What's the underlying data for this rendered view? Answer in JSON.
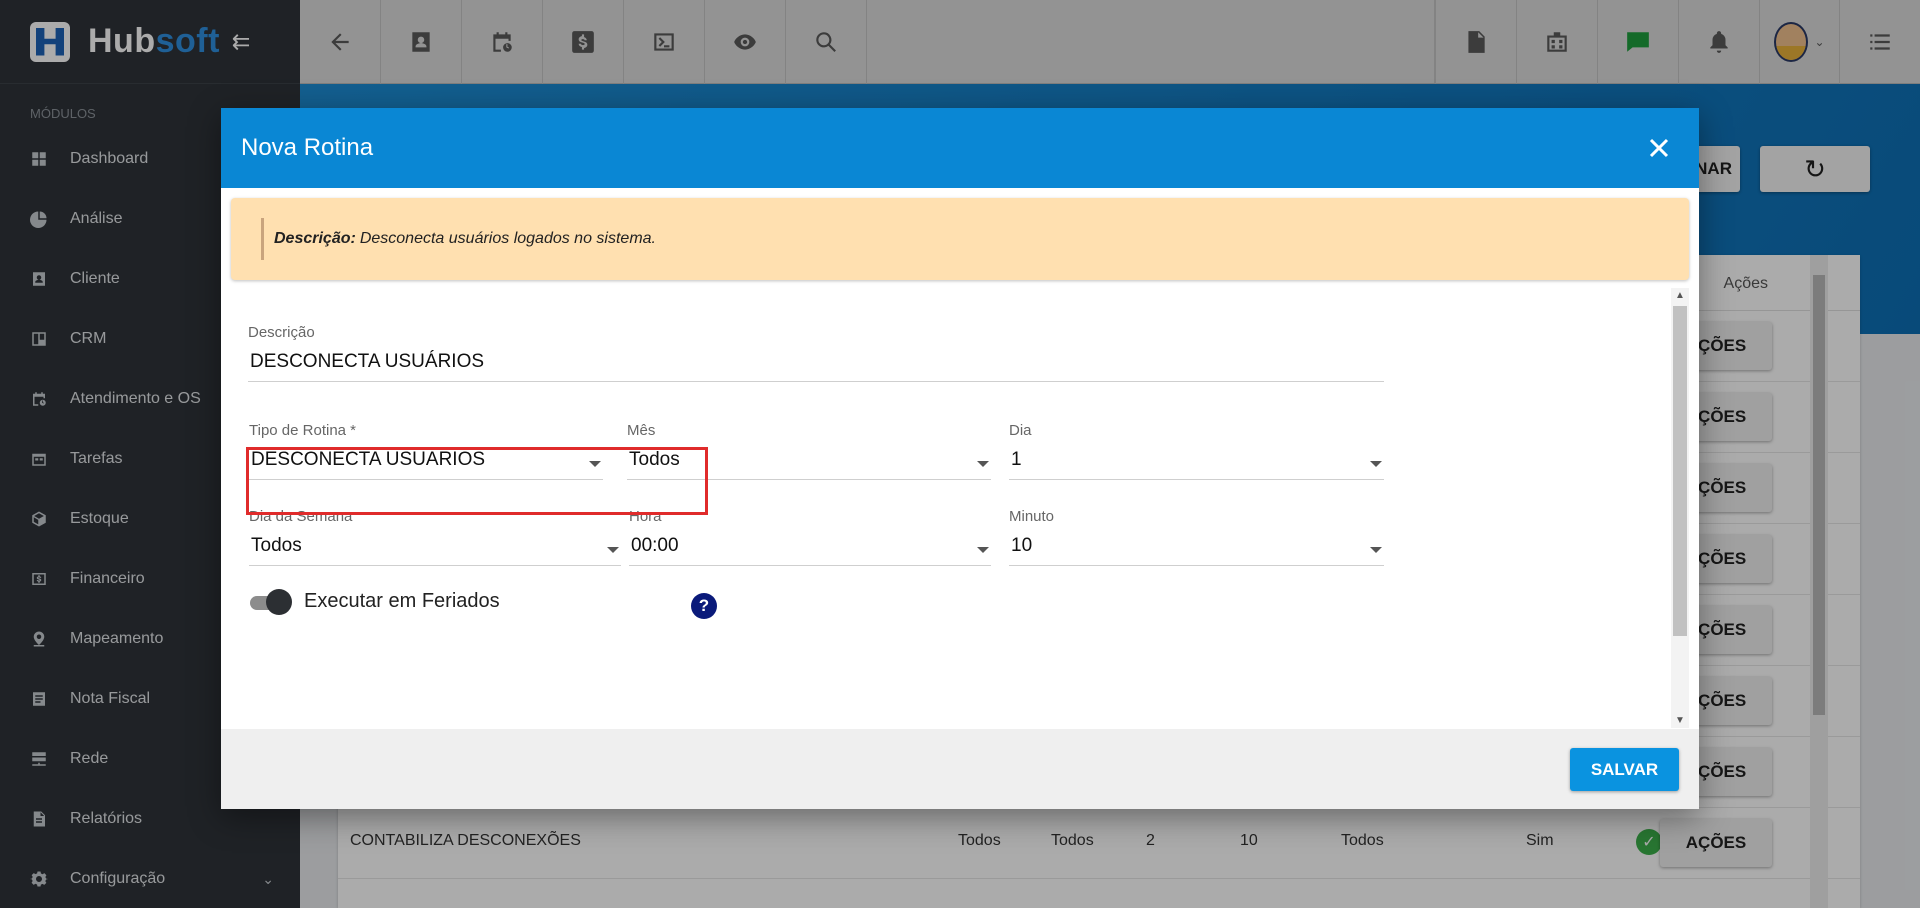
{
  "brand": {
    "name_prefix": "Hub",
    "name_suffix": "soft",
    "collapse_icon": "collapse-left-icon"
  },
  "sidebar": {
    "section_title": "MÓDULOS",
    "items": [
      {
        "label": "Dashboard",
        "icon": "dashboard-icon"
      },
      {
        "label": "Análise",
        "icon": "pie-chart-icon"
      },
      {
        "label": "Cliente",
        "icon": "contact-card-icon"
      },
      {
        "label": "CRM",
        "icon": "board-icon"
      },
      {
        "label": "Atendimento e OS",
        "icon": "calendar-clock-icon"
      },
      {
        "label": "Tarefas",
        "icon": "tasks-icon"
      },
      {
        "label": "Estoque",
        "icon": "box-icon"
      },
      {
        "label": "Financeiro",
        "icon": "money-icon"
      },
      {
        "label": "Mapeamento",
        "icon": "map-pin-icon"
      },
      {
        "label": "Nota Fiscal",
        "icon": "document-icon"
      },
      {
        "label": "Rede",
        "icon": "server-icon"
      },
      {
        "label": "Relatórios",
        "icon": "report-icon"
      },
      {
        "label": "Configuração",
        "icon": "gear-icon"
      }
    ]
  },
  "topbar": {
    "left_icons": [
      "back-arrow-icon",
      "contact-icon",
      "calendar-clock-icon",
      "dollar-icon",
      "terminal-icon",
      "eye-icon",
      "search-icon"
    ],
    "right_icons": [
      "pdf-icon",
      "building-icon",
      "chat-check-icon",
      "bell-icon",
      "avatar",
      "menu-list-icon"
    ]
  },
  "background": {
    "header_buttons": {
      "partial_label": "NAR",
      "refresh_icon": "refresh-icon"
    },
    "table": {
      "actions_header": "Ações",
      "action_button": "AÇÕES",
      "visible_row": {
        "descricao": "CONTABILIZA DESCONEXÕES",
        "mes": "Todos",
        "dia_semana": "Todos",
        "hora": "2",
        "minuto": "10",
        "dia": "Todos",
        "feriados": "Sim",
        "status_icon": "check-circle-icon"
      }
    }
  },
  "modal": {
    "title": "Nova Rotina",
    "info": {
      "label": "Descrição:",
      "text": "Desconecta usuários logados no sistema."
    },
    "fields": {
      "descricao": {
        "label": "Descrição",
        "value": "DESCONECTA USUÁRIOS"
      },
      "tipo_rotina": {
        "label": "Tipo de Rotina *",
        "value": "DESCONECTA USUARIOS"
      },
      "mes": {
        "label": "Mês",
        "value": "Todos"
      },
      "dia": {
        "label": "Dia",
        "value": "1"
      },
      "dia_semana": {
        "label": "Dia da Semana",
        "value": "Todos"
      },
      "hora": {
        "label": "Hora",
        "value": "00:00"
      },
      "minuto": {
        "label": "Minuto",
        "value": "10"
      }
    },
    "toggle": {
      "label": "Executar em Feriados",
      "on": true
    },
    "help_icon_text": "?",
    "save_label": "SALVAR"
  }
}
